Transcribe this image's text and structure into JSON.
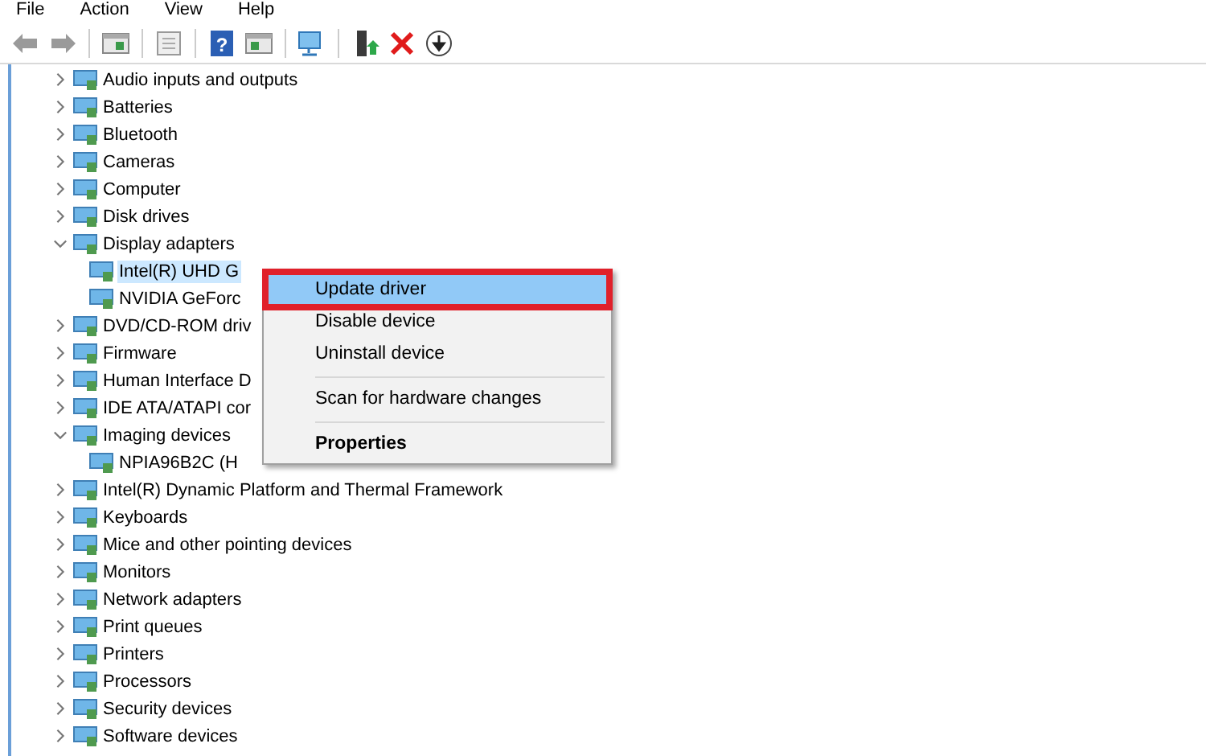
{
  "menu_bar": [
    "File",
    "Action",
    "View",
    "Help"
  ],
  "toolbar": {
    "help_glyph": "?"
  },
  "tree": [
    {
      "label": "Audio inputs and outputs",
      "expanded": false,
      "selected": false
    },
    {
      "label": "Batteries",
      "expanded": false,
      "selected": false
    },
    {
      "label": "Bluetooth",
      "expanded": false,
      "selected": false
    },
    {
      "label": "Cameras",
      "expanded": false,
      "selected": false
    },
    {
      "label": "Computer",
      "expanded": false,
      "selected": false
    },
    {
      "label": "Disk drives",
      "expanded": false,
      "selected": false
    },
    {
      "label": "Display adapters",
      "expanded": true,
      "selected": false,
      "children": [
        {
          "label": "Intel(R) UHD G",
          "selected": true
        },
        {
          "label": "NVIDIA GeForc",
          "selected": false
        }
      ]
    },
    {
      "label": "DVD/CD-ROM driv",
      "expanded": false,
      "selected": false
    },
    {
      "label": "Firmware",
      "expanded": false,
      "selected": false
    },
    {
      "label": "Human Interface D",
      "expanded": false,
      "selected": false
    },
    {
      "label": "IDE ATA/ATAPI cor",
      "expanded": false,
      "selected": false
    },
    {
      "label": "Imaging devices",
      "expanded": true,
      "selected": false,
      "children": [
        {
          "label": "NPIA96B2C (H",
          "selected": false
        }
      ]
    },
    {
      "label": "Intel(R) Dynamic Platform and Thermal Framework",
      "expanded": false,
      "selected": false
    },
    {
      "label": "Keyboards",
      "expanded": false,
      "selected": false
    },
    {
      "label": "Mice and other pointing devices",
      "expanded": false,
      "selected": false
    },
    {
      "label": "Monitors",
      "expanded": false,
      "selected": false
    },
    {
      "label": "Network adapters",
      "expanded": false,
      "selected": false
    },
    {
      "label": "Print queues",
      "expanded": false,
      "selected": false
    },
    {
      "label": "Printers",
      "expanded": false,
      "selected": false
    },
    {
      "label": "Processors",
      "expanded": false,
      "selected": false
    },
    {
      "label": "Security devices",
      "expanded": false,
      "selected": false
    },
    {
      "label": "Software devices",
      "expanded": false,
      "selected": false
    }
  ],
  "context_menu": [
    {
      "kind": "item",
      "label": "Update driver",
      "selected": true,
      "annotated": true,
      "default": false
    },
    {
      "kind": "item",
      "label": "Disable device",
      "selected": false,
      "annotated": false,
      "default": false
    },
    {
      "kind": "item",
      "label": "Uninstall device",
      "selected": false,
      "annotated": false,
      "default": false
    },
    {
      "kind": "separator"
    },
    {
      "kind": "item",
      "label": "Scan for hardware changes",
      "selected": false,
      "annotated": false,
      "default": false
    },
    {
      "kind": "separator"
    },
    {
      "kind": "item",
      "label": "Properties",
      "selected": false,
      "annotated": false,
      "default": true
    }
  ]
}
